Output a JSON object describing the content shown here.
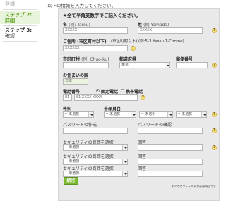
{
  "sidebar": {
    "items": [
      {
        "label": "登録",
        "state": "done"
      },
      {
        "label": "ステップ 2:",
        "sub": "詳細",
        "state": "active"
      },
      {
        "label": "ステップ 3:",
        "sub": "確認",
        "state": "upcoming"
      }
    ]
  },
  "intro": "以下の情報を入力してください。",
  "form": {
    "required_note": "★全て半角英数字でご記入ください。",
    "last_name": {
      "label": "名",
      "example": "(例: Tarou)",
      "value": "XXXXX"
    },
    "first_name": {
      "label": "姓",
      "example": "(例:Yamada)",
      "value": "XXXXX"
    },
    "address": {
      "label": "ご住所 (市区町村以下)",
      "example": "(市区町村以下) (例:5-3 Yaesu 1-Chome)",
      "value": "XXXXXX"
    },
    "city": {
      "label": "市区町村",
      "example": "(例: Chuo-ku)",
      "value": ""
    },
    "prefecture": {
      "label": "都道府県",
      "value": "東京"
    },
    "postal": {
      "label": "郵便番号",
      "value": ""
    },
    "country": {
      "label": "お住まいの国",
      "value": "日本"
    },
    "phone": {
      "label": "電話番号",
      "options": [
        "固定電話",
        "携帯電話"
      ],
      "selected": "固定電話",
      "code": "81",
      "value": "81-XXXX-XXXX"
    },
    "gender": {
      "label": "性別",
      "value": "-- 未選択"
    },
    "birthday": {
      "label": "生年月日",
      "year": "-- 未選択",
      "month": "-- 未選択",
      "day": "-- 未選択"
    },
    "password_create": {
      "label": "パスワードの作成"
    },
    "password_confirm": {
      "label": "パスワードの確認"
    },
    "security": [
      {
        "question_label": "セキュリティの質問を選択",
        "answer_label": "回答",
        "value": "-- 未選択"
      },
      {
        "question_label": "セキュリティの質問を選択",
        "answer_label": "回答",
        "value": "-- 未選択"
      },
      {
        "question_label": "セキュリティの質問を選択",
        "answer_label": "回答",
        "value": "-- 未選択"
      }
    ],
    "help_icon_text": "?",
    "continue_label": "続行",
    "footer_note": "すべてのフィールドが必須項目です"
  },
  "colors": {
    "accent": "#7ab82e",
    "panel": "#e9e9e9",
    "help": "#f6e27a"
  }
}
